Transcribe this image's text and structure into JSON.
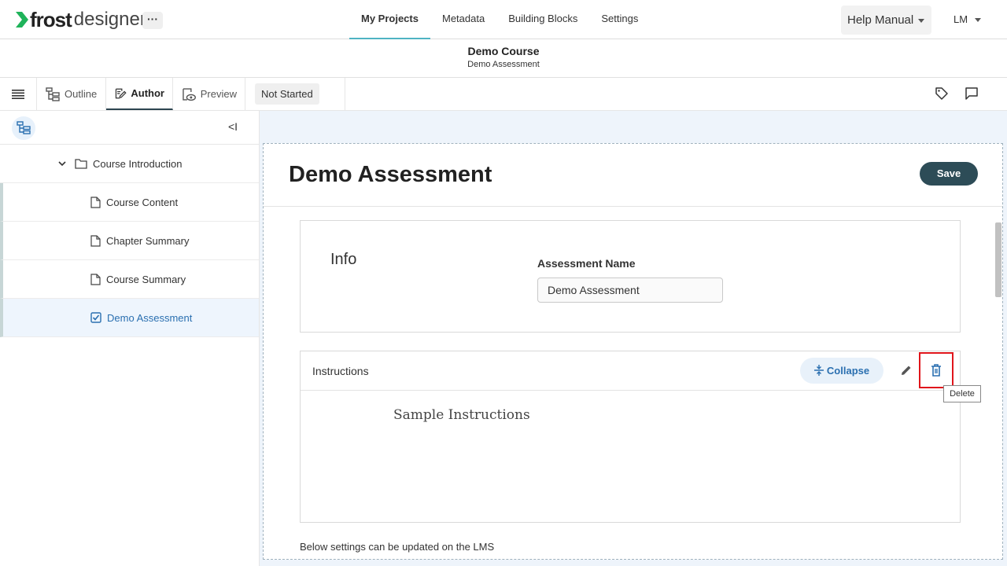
{
  "brand": {
    "name_bold": "frost",
    "name_light": "designer"
  },
  "topnav": {
    "more_label": "···",
    "links": [
      {
        "label": "My Projects"
      },
      {
        "label": "Metadata"
      },
      {
        "label": "Building Blocks"
      },
      {
        "label": "Settings"
      }
    ],
    "help_label": "Help Manual",
    "user_initials": "LM"
  },
  "course": {
    "title": "Demo Course",
    "subtitle": "Demo Assessment"
  },
  "toolbar": {
    "tabs": [
      {
        "label": "Outline"
      },
      {
        "label": "Author"
      },
      {
        "label": "Preview"
      }
    ],
    "status": "Not Started"
  },
  "sidebar": {
    "collapse_glyph": "<I",
    "folder": {
      "label": "Course Introduction"
    },
    "items": [
      {
        "label": "Course Content"
      },
      {
        "label": "Chapter Summary"
      },
      {
        "label": "Course Summary"
      },
      {
        "label": "Demo Assessment"
      }
    ]
  },
  "editor": {
    "title": "Demo Assessment",
    "save_label": "Save",
    "info": {
      "section_label": "Info",
      "field_label": "Assessment Name",
      "field_value": "Demo Assessment"
    },
    "instructions": {
      "title": "Instructions",
      "collapse_label": "Collapse",
      "body": "Sample Instructions"
    },
    "below_note": "Below settings can be updated on the LMS",
    "tooltip": "Delete"
  },
  "colors": {
    "accent": "#4fb3c3",
    "save_bg": "#2d4c57",
    "link_blue": "#2a6fb0",
    "highlight": "#e0151b"
  }
}
